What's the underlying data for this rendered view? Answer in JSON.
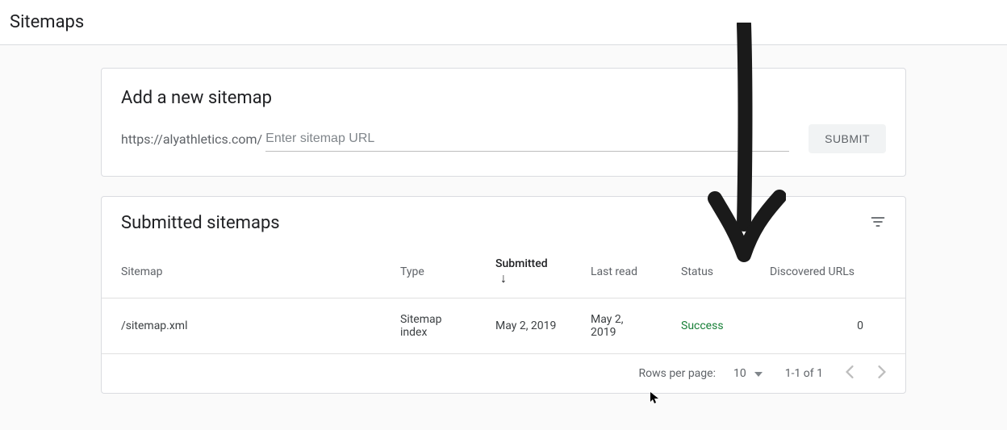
{
  "page": {
    "title": "Sitemaps"
  },
  "addSitemap": {
    "title": "Add a new sitemap",
    "domainPrefix": "https://alyathletics.com/",
    "placeholder": "Enter sitemap URL",
    "submitLabel": "SUBMIT"
  },
  "submitted": {
    "title": "Submitted sitemaps",
    "columns": {
      "sitemap": "Sitemap",
      "type": "Type",
      "submitted": "Submitted",
      "lastRead": "Last read",
      "status": "Status",
      "discoveredUrls": "Discovered URLs"
    },
    "rows": [
      {
        "sitemap": "/sitemap.xml",
        "type": "Sitemap index",
        "submitted": "May 2, 2019",
        "lastRead": "May 2, 2019",
        "status": "Success",
        "discoveredUrls": "0"
      }
    ]
  },
  "pagination": {
    "rowsPerPageLabel": "Rows per page:",
    "rowsPerPage": "10",
    "rangeLabel": "1-1 of 1"
  }
}
